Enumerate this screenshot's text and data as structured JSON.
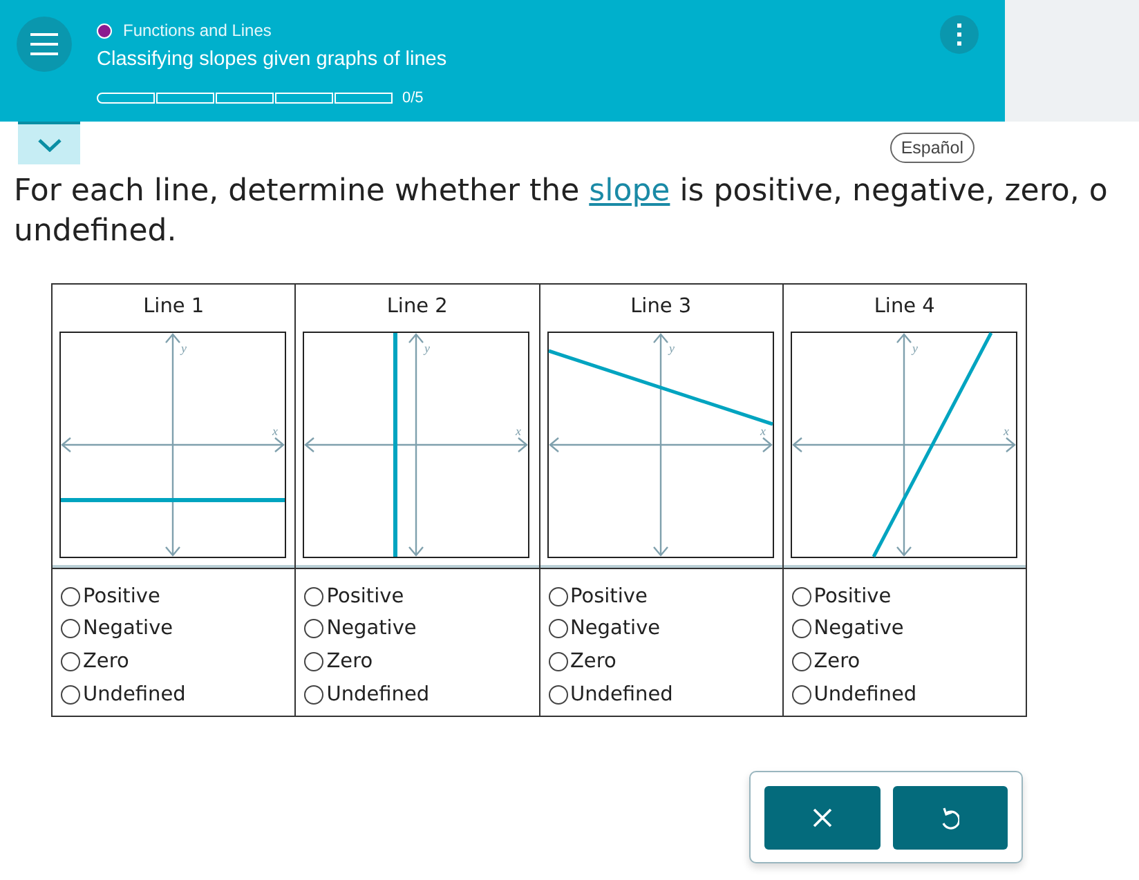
{
  "header": {
    "topic": "Functions and Lines",
    "title": "Classifying slopes given graphs of lines",
    "progress": [
      {
        "filled": false
      },
      {
        "filled": false
      },
      {
        "filled": false
      },
      {
        "filled": false
      },
      {
        "filled": false
      }
    ],
    "progress_text": "0/5"
  },
  "language_button": "Español",
  "instruction": {
    "before": "For each line, determine whether the ",
    "link": "slope",
    "after": " is positive, negative, zero, o",
    "line2": "undefined."
  },
  "lines": [
    {
      "label": "Line 1",
      "graph": {
        "kind": "horizontal",
        "x_label": "x",
        "y_label": "y"
      },
      "options": [
        {
          "label": "Positive",
          "selected": false
        },
        {
          "label": "Negative",
          "selected": false
        },
        {
          "label": "Zero",
          "selected": false
        },
        {
          "label": "Undefined",
          "selected": false
        }
      ]
    },
    {
      "label": "Line 2",
      "graph": {
        "kind": "vertical",
        "x_label": "x",
        "y_label": "y"
      },
      "options": [
        {
          "label": "Positive",
          "selected": false
        },
        {
          "label": "Negative",
          "selected": false
        },
        {
          "label": "Zero",
          "selected": false
        },
        {
          "label": "Undefined",
          "selected": false
        }
      ]
    },
    {
      "label": "Line 3",
      "graph": {
        "kind": "negative",
        "x_label": "x",
        "y_label": "y"
      },
      "options": [
        {
          "label": "Positive",
          "selected": false
        },
        {
          "label": "Negative",
          "selected": false
        },
        {
          "label": "Zero",
          "selected": false
        },
        {
          "label": "Undefined",
          "selected": false
        }
      ]
    },
    {
      "label": "Line 4",
      "graph": {
        "kind": "positive",
        "x_label": "x",
        "y_label": "y"
      },
      "options": [
        {
          "label": "Positive",
          "selected": false
        },
        {
          "label": "Negative",
          "selected": false
        },
        {
          "label": "Zero",
          "selected": false
        },
        {
          "label": "Undefined",
          "selected": false
        }
      ]
    }
  ]
}
